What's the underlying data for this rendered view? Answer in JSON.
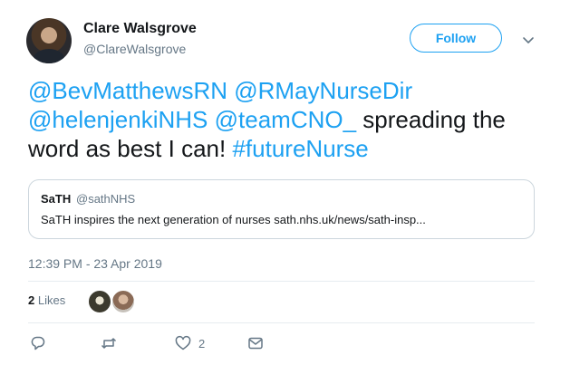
{
  "author": {
    "name": "Clare Walsgrove",
    "handle": "@ClareWalsgrove"
  },
  "follow_label": "Follow",
  "tweet": {
    "mention1": "@BevMatthewsRN",
    "mention2": "@RMayNurseDir",
    "mention3": "@helenjenkiNHS",
    "mention4": "@teamCNO_",
    "text_part": "spreading the word as best I can!",
    "hashtag": "#futureNurse"
  },
  "quote": {
    "name": "SaTH",
    "handle": "@sathNHS",
    "text": "SaTH inspires the next generation of nurses sath.nhs.uk/news/sath-insp..."
  },
  "timestamp": "12:39 PM - 23 Apr 2019",
  "likes": {
    "count": "2",
    "label": "Likes"
  },
  "actions": {
    "like_count": "2"
  },
  "colors": {
    "accent": "#1da1f2",
    "muted": "#657786",
    "border": "#ccd6dd"
  }
}
